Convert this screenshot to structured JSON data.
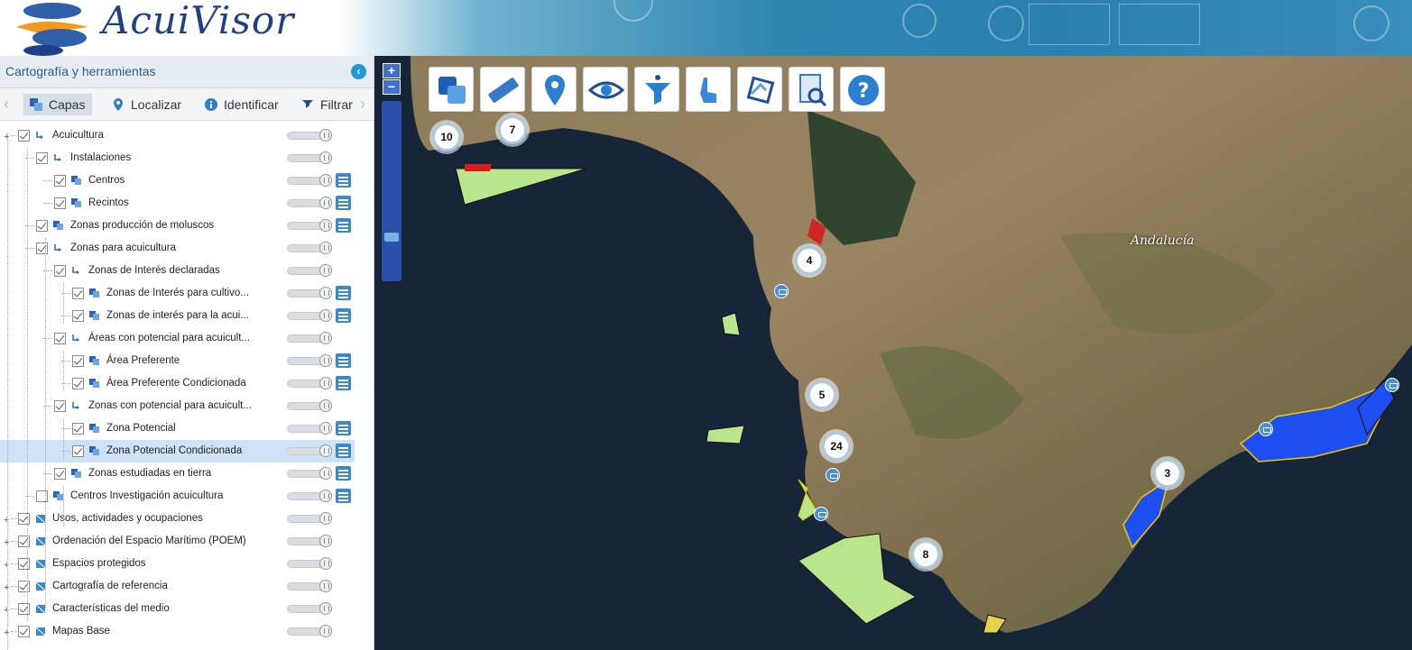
{
  "app": {
    "name": "AcuiVisor"
  },
  "panel": {
    "title": "Cartografía y herramientas"
  },
  "tabs": [
    {
      "label": "Capas",
      "icon": "layers-icon",
      "active": true
    },
    {
      "label": "Localizar",
      "icon": "location-pin-icon",
      "active": false
    },
    {
      "label": "Identificar",
      "icon": "info-icon",
      "active": false
    },
    {
      "label": "Filtrar",
      "icon": "filter-icon",
      "active": false
    }
  ],
  "layers": [
    {
      "label": "Acuicultura",
      "checked": true,
      "expandable": true,
      "legend": false
    },
    {
      "label": "Instalaciones",
      "checked": true,
      "expandable": false,
      "legend": false
    },
    {
      "label": "Centros",
      "checked": true,
      "expandable": false,
      "legend": true
    },
    {
      "label": "Recintos",
      "checked": true,
      "expandable": false,
      "legend": true
    },
    {
      "label": "Zonas producción de moluscos",
      "checked": true,
      "expandable": false,
      "legend": true
    },
    {
      "label": "Zonas para acuicultura",
      "checked": true,
      "expandable": false,
      "legend": false
    },
    {
      "label": "Zonas de Interés declaradas",
      "checked": true,
      "expandable": false,
      "legend": false
    },
    {
      "label": "Zonas de Interés para cultivo...",
      "checked": true,
      "expandable": false,
      "legend": true
    },
    {
      "label": "Zonas de interés para la acui...",
      "checked": true,
      "expandable": false,
      "legend": true
    },
    {
      "label": "Áreas con potencial para acuicult...",
      "checked": true,
      "expandable": false,
      "legend": false
    },
    {
      "label": "Área Preferente",
      "checked": true,
      "expandable": false,
      "legend": true
    },
    {
      "label": "Área Preferente Condicionada",
      "checked": true,
      "expandable": false,
      "legend": true
    },
    {
      "label": "Zonas con potencial para acuicult...",
      "checked": true,
      "expandable": false,
      "legend": false
    },
    {
      "label": "Zona Potencial",
      "checked": true,
      "expandable": false,
      "legend": true
    },
    {
      "label": "Zona Potencial Condicionada",
      "checked": true,
      "expandable": false,
      "legend": true,
      "selected": true
    },
    {
      "label": "Zonas estudiadas en tierra",
      "checked": true,
      "expandable": false,
      "legend": true
    },
    {
      "label": "Centros Investigación acuicultura",
      "checked": false,
      "expandable": false,
      "legend": true
    },
    {
      "label": "Usos, actividades y ocupaciones",
      "checked": true,
      "expandable": true,
      "legend": false
    },
    {
      "label": "Ordenación del Espacio Marítimo (POEM)",
      "checked": true,
      "expandable": true,
      "legend": false
    },
    {
      "label": "Espacios protegidos",
      "checked": true,
      "expandable": true,
      "legend": false
    },
    {
      "label": "Cartografía de referencia",
      "checked": true,
      "expandable": true,
      "legend": false
    },
    {
      "label": "Características del medio",
      "checked": true,
      "expandable": true,
      "legend": false
    },
    {
      "label": "Mapas Base",
      "checked": true,
      "expandable": true,
      "legend": false
    }
  ],
  "toolbar": [
    {
      "icon": "layers-tool-icon"
    },
    {
      "icon": "ruler-icon"
    },
    {
      "icon": "map-pin-icon"
    },
    {
      "icon": "eye-icon"
    },
    {
      "icon": "funnel-icon"
    },
    {
      "icon": "pointer-hand-icon"
    },
    {
      "icon": "rotate-refresh-icon"
    },
    {
      "icon": "document-search-icon"
    },
    {
      "icon": "help-icon"
    }
  ],
  "zoom": {
    "plus": "+",
    "minus": "−"
  },
  "map": {
    "region_label": "Andalucía",
    "clusters": [
      "10",
      "7",
      "4",
      "5",
      "24",
      "3",
      "8"
    ]
  },
  "colors": {
    "accent": "#1f98d6",
    "selected_row": "#cde2f6",
    "brand": "#1f3f86",
    "zone_fill": "#b9e68c",
    "potential_zone": "#1d4ff0"
  }
}
